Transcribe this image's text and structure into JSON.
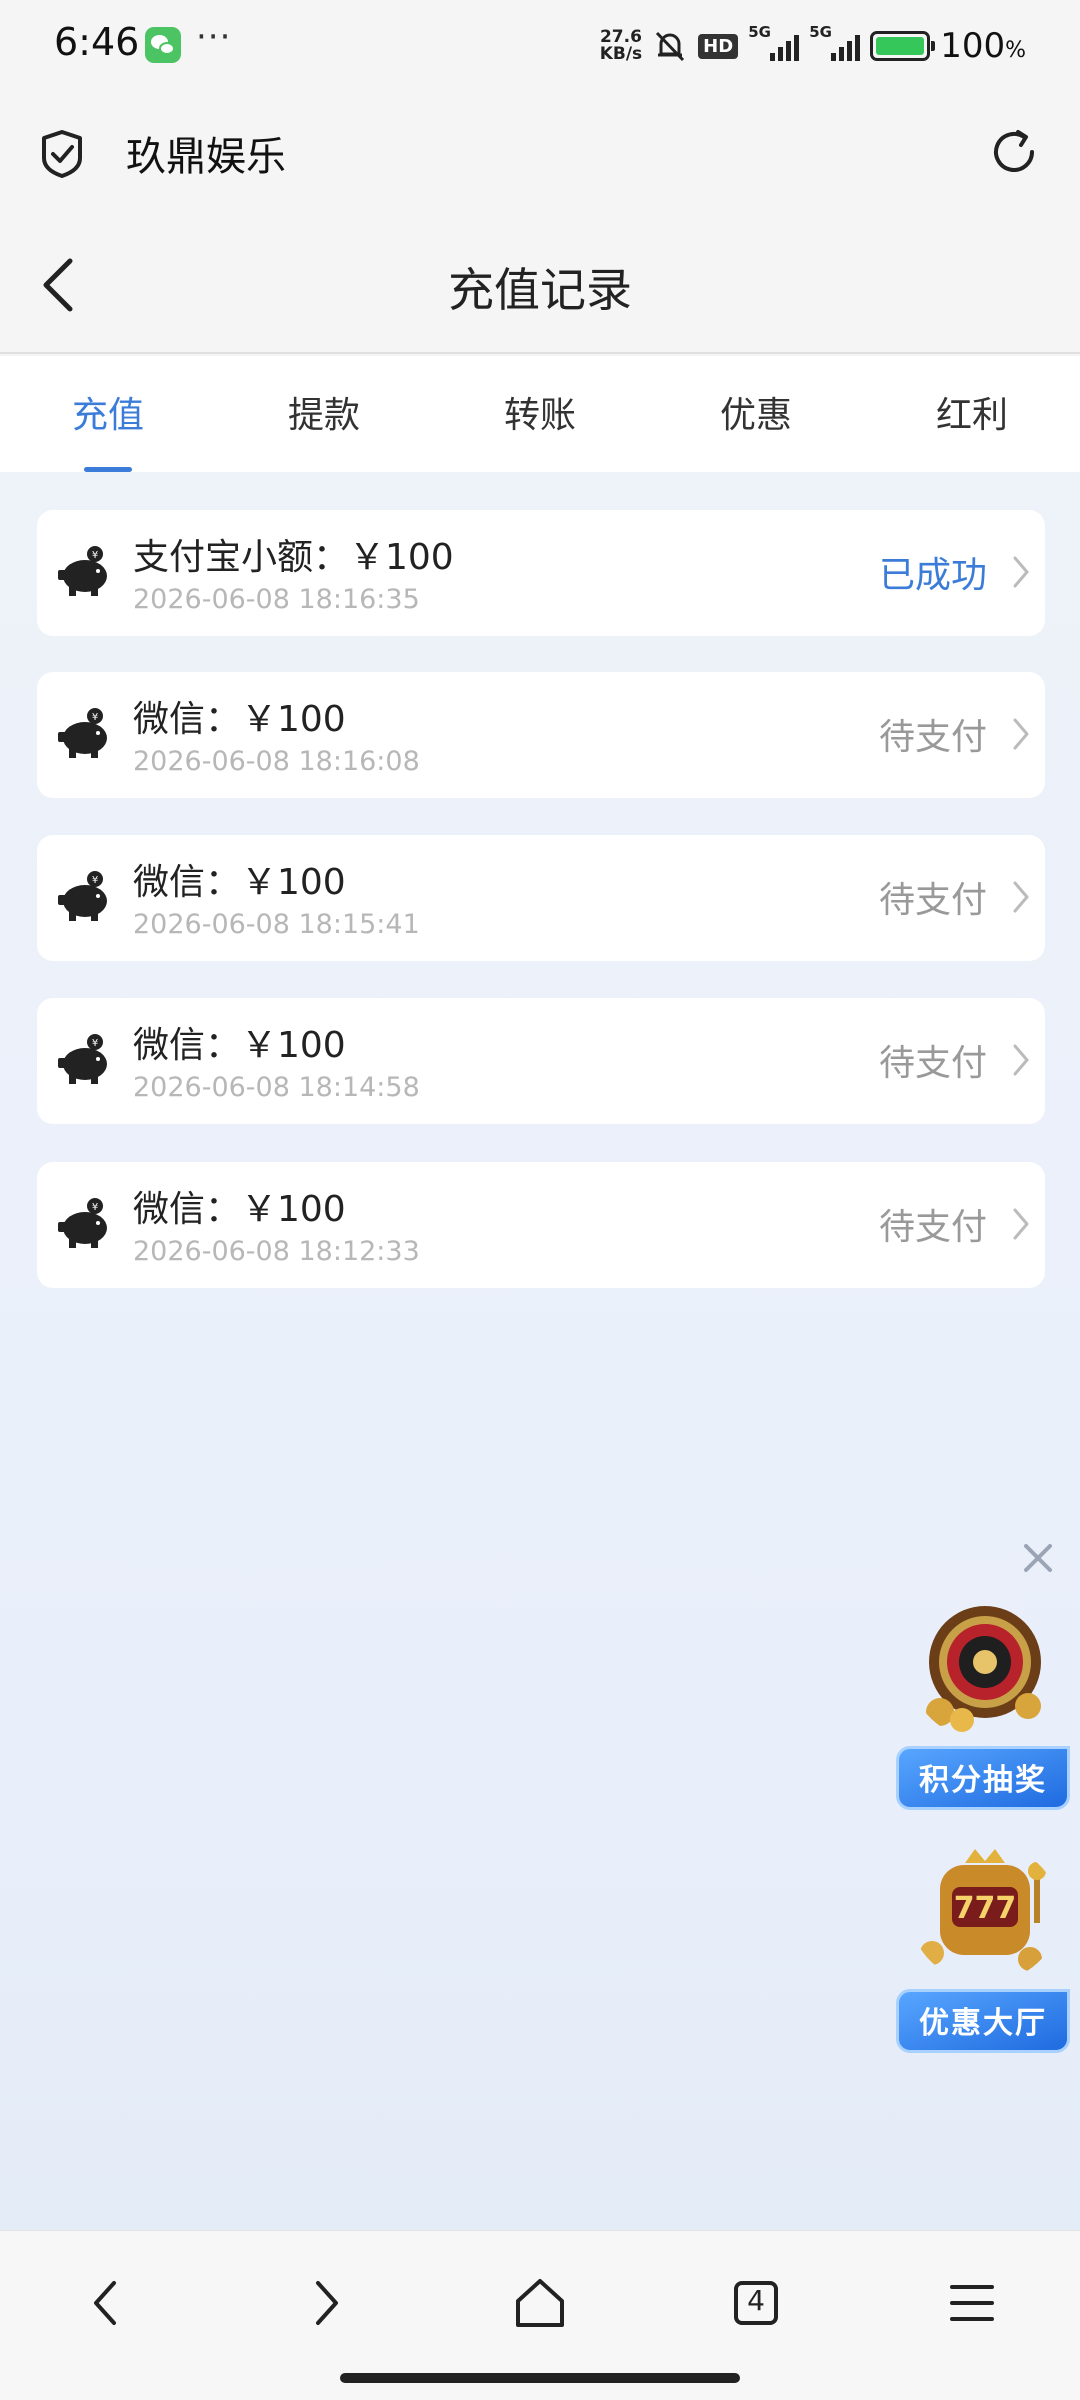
{
  "status_bar": {
    "time": "6:46",
    "more": "···",
    "net_speed_value": "27.6",
    "net_speed_unit": "KB/s",
    "hd": "HD",
    "signal1": "5G",
    "signal2": "5G",
    "battery": "100",
    "battery_unit": "%"
  },
  "app": {
    "title": "玖鼎娱乐"
  },
  "nav": {
    "title": "充值记录"
  },
  "tabs": [
    {
      "label": "充值",
      "active": true
    },
    {
      "label": "提款",
      "active": false
    },
    {
      "label": "转账",
      "active": false
    },
    {
      "label": "优惠",
      "active": false
    },
    {
      "label": "红利",
      "active": false
    }
  ],
  "records": [
    {
      "title": "支付宝小额：￥100",
      "time": "2026-06-08 18:16:35",
      "status": "已成功",
      "status_color": "#3b7cd8"
    },
    {
      "title": "微信：￥100",
      "time": "2026-06-08 18:16:08",
      "status": "待支付",
      "status_color": "#999999"
    },
    {
      "title": "微信：￥100",
      "time": "2026-06-08 18:15:41",
      "status": "待支付",
      "status_color": "#999999"
    },
    {
      "title": "微信：￥100",
      "time": "2026-06-08 18:14:58",
      "status": "待支付",
      "status_color": "#999999"
    },
    {
      "title": "微信：￥100",
      "time": "2026-06-08 18:12:33",
      "status": "待支付",
      "status_color": "#999999"
    }
  ],
  "promos": {
    "lottery_label": "积分抽奖",
    "hall_label": "优惠大厅"
  },
  "browser": {
    "tab_count": "4"
  },
  "colors": {
    "accent": "#3b7cd8",
    "pending": "#999999"
  }
}
